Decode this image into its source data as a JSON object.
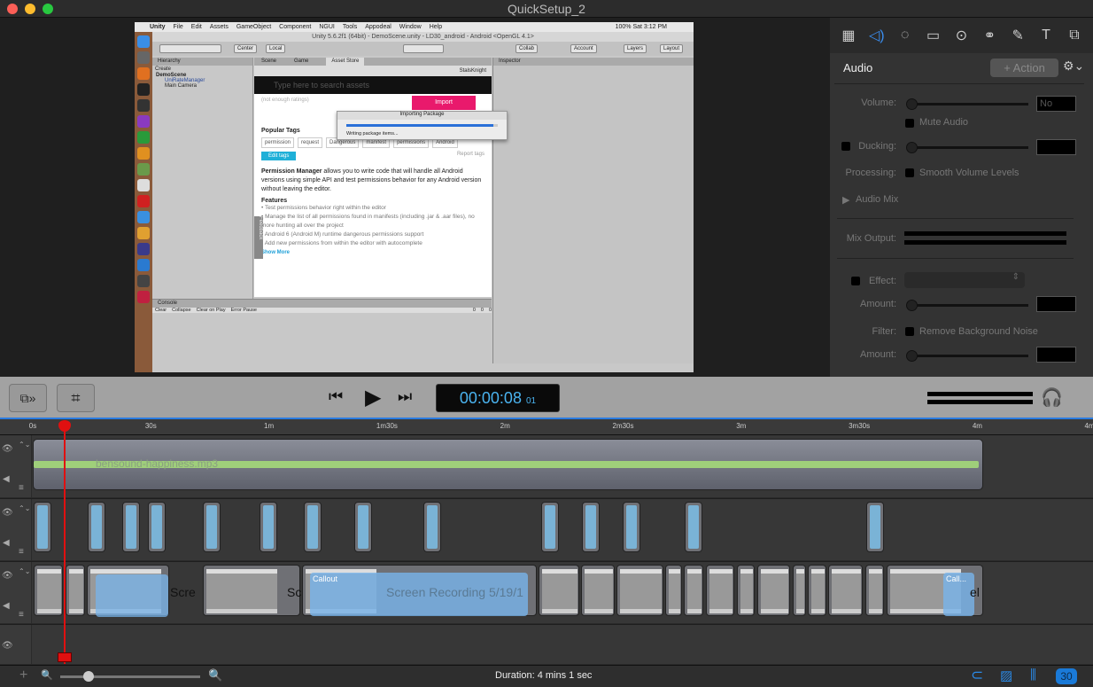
{
  "window": {
    "title": "QuickSetup_2"
  },
  "unity": {
    "menu": [
      "Unity",
      "File",
      "Edit",
      "Assets",
      "GameObject",
      "Component",
      "NGUI",
      "Tools",
      "Appodeal",
      "Window",
      "Help"
    ],
    "status": "100%  Sat 3:12 PM",
    "title": "Unity 5.6.2f1 (64bit) - DemoScene.unity - LD30_android - Android <OpenGL 4.1>",
    "center": "Center",
    "local": "Local",
    "collab": "Collab",
    "account": "Account",
    "layers": "Layers",
    "layout": "Layout",
    "hierarchy_tab": "Hierarchy",
    "create": "Create",
    "search_all": "All",
    "hier_items": [
      "DemoScene",
      "UniRateManager",
      "Main Camera"
    ],
    "tabs": [
      "Scene",
      "Game",
      "Asset Store"
    ],
    "inspector_tab": "Inspector",
    "user": "StalsKnight",
    "search_placeholder": "Type here to search assets",
    "ratings": "(not enough ratings)",
    "import": "Import",
    "dialog_title": "Importing Package",
    "dialog_status": "Writing package items...",
    "dialog_progress": 0.97,
    "popular_tags": "Popular Tags",
    "tags": [
      "permission",
      "request",
      "Dangerous",
      "manifest",
      "permissions",
      "Android"
    ],
    "edit_tags": "Edit tags",
    "report_tags": "Report tags",
    "desc_bold": "Permission Manager",
    "desc": " allows you to write code that will handle all Android versions using simple API and test permissions behavior for any Android version without leaving the editor.",
    "features": "Features",
    "feature_items": [
      "• Test permissions behavior right within the editor",
      "• Manage the list of all permissions found in manifests (including .jar & .aar files), no more hunting all over the project",
      "• Android 6 (Android M) runtime dangerous permissions support",
      "• Add new permissions from within the editor with autocomplete"
    ],
    "show_more": "Show More",
    "feedback": "Feedback",
    "console_tab": "Console",
    "console_buttons": [
      "Clear",
      "Collapse",
      "Clear on Play",
      "Error Pause"
    ],
    "console_counts": [
      "0",
      "0",
      "0"
    ]
  },
  "right_panel": {
    "tools": [
      "media",
      "audio",
      "animations",
      "screen",
      "cursor",
      "transitions",
      "annotations",
      "text",
      "more"
    ],
    "heading": "Audio",
    "action_button": "+ Action",
    "volume_label": "Volume:",
    "volume_value": "No Selection",
    "mute_label": "Mute Audio",
    "ducking_label": "Ducking:",
    "processing_label": "Processing:",
    "smooth_label": "Smooth Volume Levels",
    "audio_mix_label": "Audio Mix",
    "mix_output_label": "Mix Output:",
    "effect_label": "Effect:",
    "amount_label": "Amount:",
    "filter_label": "Filter:",
    "noise_label": "Remove Background Noise"
  },
  "controls": {
    "timecode": "00:00:08",
    "frames": "01"
  },
  "timeline": {
    "ticks": [
      "0s",
      "30s",
      "1m",
      "1m30s",
      "2m",
      "2m30s",
      "3m",
      "3m30s",
      "4m",
      "4m"
    ],
    "audio_clip": "bensound-happiness.mp3",
    "clip_labels": [
      "Scre",
      "Sc",
      "Screen Recording 5/19/1",
      "el"
    ],
    "callout_labels": [
      "Callout",
      "Call..."
    ],
    "playhead_seconds": 8
  },
  "bottom": {
    "duration": "Duration: 4 mins 1 sec",
    "fps": "30",
    "zoom_level": 0.2
  }
}
